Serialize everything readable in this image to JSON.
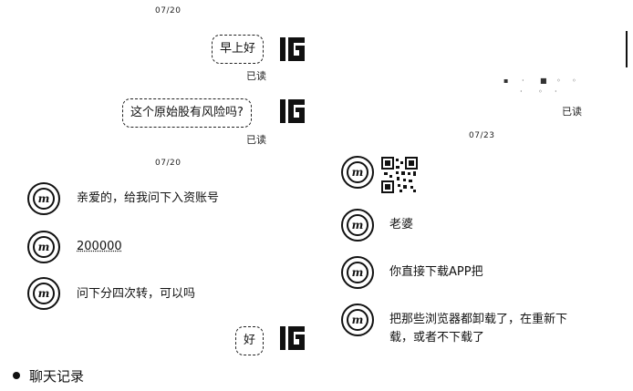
{
  "left_panel": {
    "dates": [
      "07/20",
      "07/20"
    ],
    "sent": [
      {
        "text": "早上好",
        "status": "已读"
      },
      {
        "text": "这个原始股有风险吗?",
        "status": "已读"
      },
      {
        "text": "好"
      }
    ],
    "received": [
      {
        "text": "亲爱的，给我问下入资账号"
      },
      {
        "text": "200000"
      },
      {
        "text": "问下分四次转，可以吗"
      }
    ]
  },
  "right_panel": {
    "read_status": "已读",
    "date": "07/23",
    "received": [
      {
        "type": "qr-code"
      },
      {
        "text": "老婆"
      },
      {
        "text": "你直接下载APP把"
      },
      {
        "text": "把那些浏览器都卸载了，在重新下载，或者不下载了"
      }
    ]
  },
  "caption": "聊天记录",
  "icons": {
    "sender_avatar": "ig-logo-icon",
    "receiver_avatar": "circle-logo-icon",
    "qr": "qr-code-icon"
  }
}
